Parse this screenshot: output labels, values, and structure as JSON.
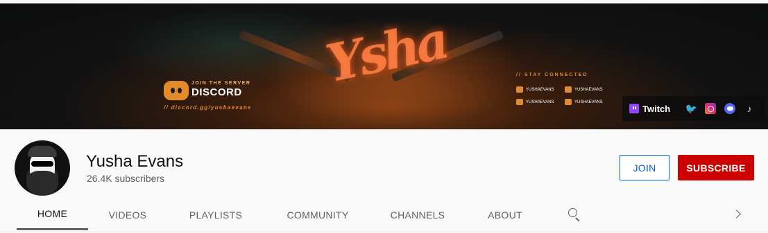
{
  "banner": {
    "join_the_server": "JOIN THE SERVER",
    "discord_word": "DISCORD",
    "discord_url": "// discord.gg/yushaevans",
    "stay_connected": "// STAY CONNECTED",
    "socials": [
      "YUSHAEVANS",
      "YUSHAEVANS",
      "YUSHAEVANS",
      "YUSHAEVANS"
    ],
    "logo_text": "Ysha"
  },
  "links": {
    "twitch_label": "Twitch",
    "icons": [
      "twitter-icon",
      "instagram-icon",
      "discord-icon",
      "tiktok-icon"
    ]
  },
  "channel": {
    "name": "Yusha Evans",
    "subscribers": "26.4K subscribers"
  },
  "buttons": {
    "join": "JOIN",
    "subscribe": "SUBSCRIBE"
  },
  "tabs": [
    {
      "label": "HOME",
      "active": true
    },
    {
      "label": "VIDEOS"
    },
    {
      "label": "PLAYLISTS"
    },
    {
      "label": "COMMUNITY"
    },
    {
      "label": "CHANNELS"
    },
    {
      "label": "ABOUT"
    }
  ],
  "colors": {
    "subscribe_red": "#cc0000",
    "join_blue": "#065fd4",
    "banner_accent": "#e08a35"
  }
}
